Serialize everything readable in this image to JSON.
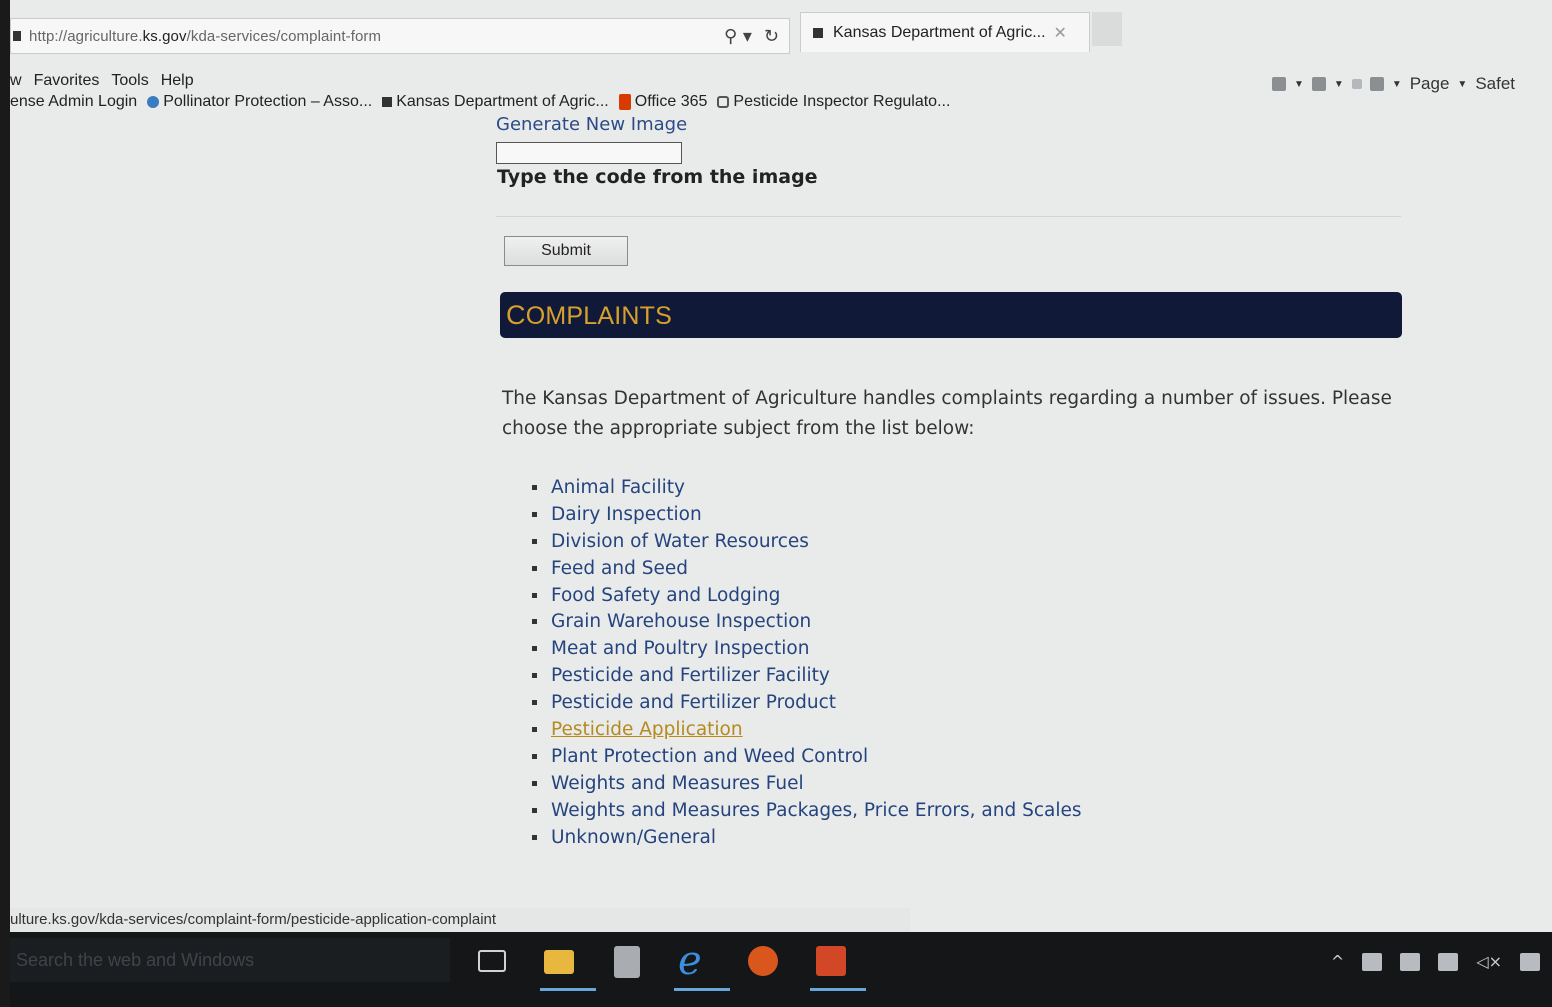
{
  "browser": {
    "address_prefix": "http://agriculture.",
    "address_host": "ks.gov",
    "address_path": "/kda-services/complaint-form",
    "tab_title": "Kansas Department of Agric...",
    "tab_close": "✕",
    "search_glyph": "⚲ ▾",
    "refresh_glyph": "↻",
    "menu": [
      "w",
      "Favorites",
      "Tools",
      "Help"
    ],
    "favorites": [
      {
        "label": "ense Admin Login",
        "icon": "none"
      },
      {
        "label": "Pollinator Protection – Asso...",
        "icon": "wordpress-icon"
      },
      {
        "label": "Kansas Department of Agric...",
        "icon": "document-icon"
      },
      {
        "label": "Office 365",
        "icon": "office-icon"
      },
      {
        "label": "Pesticide Inspector Regulato...",
        "icon": "page-icon"
      }
    ],
    "command_bar": {
      "page_label": "Page",
      "safety_label": "Safet"
    },
    "status_url": "ulture.ks.gov/kda-services/complaint-form/pesticide-application-complaint"
  },
  "form": {
    "generate_link": "Generate New Image",
    "code_label": "Type the code from the image",
    "code_value": "",
    "submit_label": "Submit"
  },
  "complaints": {
    "title_lead": "C",
    "title_rest": "OMPLAINTS",
    "intro": "The Kansas Department of Agriculture handles complaints regarding a number of issues. Please choose the appropriate subject from the list below:",
    "subjects": [
      "Animal Facility",
      "Dairy Inspection",
      "Division of Water Resources",
      "Feed and Seed",
      "Food Safety and Lodging",
      "Grain Warehouse Inspection",
      "Meat and Poultry Inspection",
      "Pesticide and Fertilizer Facility",
      "Pesticide and Fertilizer Product",
      "Pesticide Application",
      "Plant Protection and Weed Control",
      "Weights and Measures Fuel",
      "Weights and Measures Packages, Price Errors, and Scales",
      "Unknown/General"
    ],
    "link_color": "#25447f",
    "visited_color": "#b58a1e",
    "header_color": "#101a38",
    "header_text_color": "#d7a02d"
  },
  "taskbar": {
    "search_placeholder": "Search the web and Windows",
    "apps": [
      "task-view-icon",
      "file-explorer-icon",
      "calculator-icon",
      "internet-explorer-icon",
      "firefox-icon",
      "powerpoint-icon"
    ],
    "tray_up": "^",
    "tray_volume": "◁×"
  }
}
